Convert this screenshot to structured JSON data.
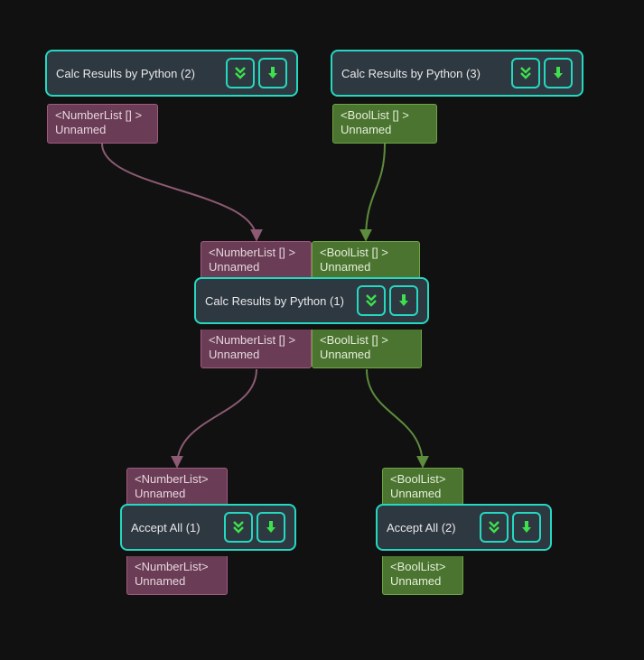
{
  "nodes": {
    "n2": {
      "title": "Calc Results by Python (2)"
    },
    "n3": {
      "title": "Calc Results by Python (3)"
    },
    "n1": {
      "title": "Calc Results by Python (1)"
    },
    "a1": {
      "title": "Accept All (1)"
    },
    "a2": {
      "title": "Accept All (2)"
    }
  },
  "ports": {
    "n2_out": {
      "type": "<NumberList [] >",
      "label": "Unnamed"
    },
    "n3_out": {
      "type": "<BoolList [] >",
      "label": "Unnamed"
    },
    "n1_in_num": {
      "type": "<NumberList [] >",
      "label": "Unnamed"
    },
    "n1_in_bool": {
      "type": "<BoolList [] >",
      "label": "Unnamed"
    },
    "n1_out_num": {
      "type": "<NumberList [] >",
      "label": "Unnamed"
    },
    "n1_out_bool": {
      "type": "<BoolList [] >",
      "label": "Unnamed"
    },
    "a1_in": {
      "type": "<NumberList>",
      "label": "Unnamed"
    },
    "a1_out": {
      "type": "<NumberList>",
      "label": "Unnamed"
    },
    "a2_in": {
      "type": "<BoolList>",
      "label": "Unnamed"
    },
    "a2_out": {
      "type": "<BoolList>",
      "label": "Unnamed"
    }
  },
  "colors": {
    "accent": "#25d9c1",
    "iconFill": "#3ee04e",
    "numPort": "#6a3c55",
    "boolPort": "#4a742f",
    "numEdge": "#8c5a72",
    "boolEdge": "#5d8c3d"
  }
}
